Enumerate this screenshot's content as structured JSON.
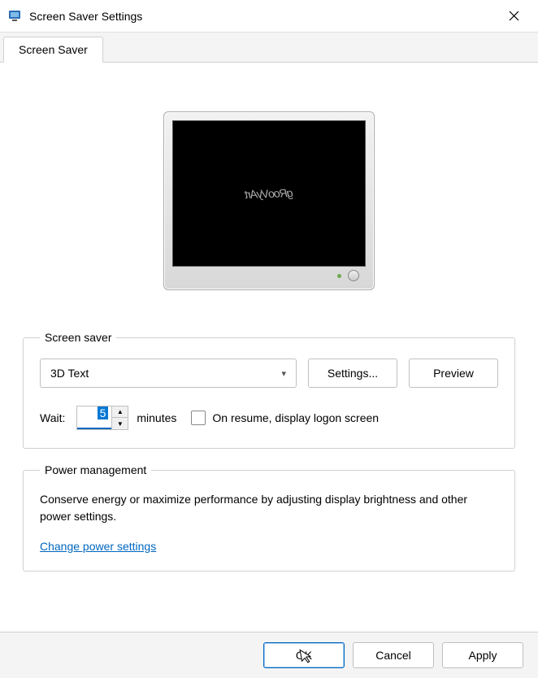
{
  "window": {
    "title": "Screen Saver Settings"
  },
  "tabs": {
    "active": "Screen Saver"
  },
  "preview": {
    "text": "gRooVyArt"
  },
  "screensaver": {
    "group_label": "Screen saver",
    "dropdown_value": "3D Text",
    "settings_button": "Settings...",
    "preview_button": "Preview",
    "wait_label": "Wait:",
    "wait_value": "5",
    "wait_unit": "minutes",
    "resume_checkbox": "On resume, display logon screen"
  },
  "power": {
    "group_label": "Power management",
    "description": "Conserve energy or maximize performance by adjusting display brightness and other power settings.",
    "link": "Change power settings"
  },
  "buttons": {
    "ok": "OK",
    "cancel": "Cancel",
    "apply": "Apply"
  }
}
